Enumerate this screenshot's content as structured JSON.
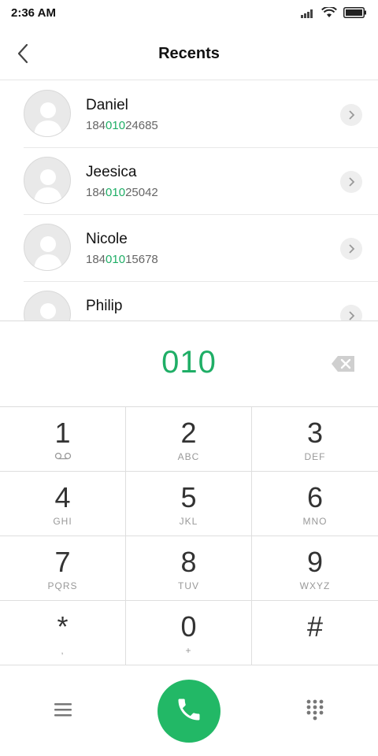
{
  "status_bar": {
    "time": "2:36 AM",
    "icons": [
      "signal-icon",
      "wifi-icon",
      "battery-icon"
    ]
  },
  "header": {
    "title": "Recents",
    "back_icon": "back-chevron-icon"
  },
  "recents": [
    {
      "name": "Daniel",
      "number_pre": "184",
      "number_match": "010",
      "number_post": "24685"
    },
    {
      "name": "Jeesica",
      "number_pre": "184",
      "number_match": "010",
      "number_post": "25042"
    },
    {
      "name": "Nicole",
      "number_pre": "184",
      "number_match": "010",
      "number_post": "15678"
    },
    {
      "name": "Philip",
      "number_pre": "",
      "number_match": "",
      "number_post": ""
    }
  ],
  "dialer": {
    "input": "010",
    "delete_icon": "backspace-icon"
  },
  "keypad": [
    {
      "digit": "1",
      "letters": ""
    },
    {
      "digit": "2",
      "letters": "ABC"
    },
    {
      "digit": "3",
      "letters": "DEF"
    },
    {
      "digit": "4",
      "letters": "GHI"
    },
    {
      "digit": "5",
      "letters": "JKL"
    },
    {
      "digit": "6",
      "letters": "MNO"
    },
    {
      "digit": "7",
      "letters": "PQRS"
    },
    {
      "digit": "8",
      "letters": "TUV"
    },
    {
      "digit": "9",
      "letters": "WXYZ"
    },
    {
      "digit": "*",
      "letters": ","
    },
    {
      "digit": "0",
      "letters": "+"
    },
    {
      "digit": "#",
      "letters": ""
    }
  ],
  "bottom_bar": {
    "menu_icon": "menu-icon",
    "call_icon": "phone-icon",
    "dialpad_icon": "dialpad-icon"
  },
  "colors": {
    "accent": "#1fae66",
    "call_button": "#22b866"
  }
}
